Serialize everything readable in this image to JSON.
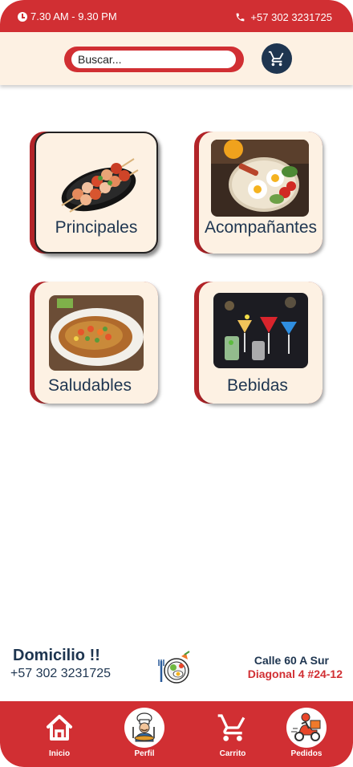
{
  "status_bar": {
    "hours": "7.30 AM - 9.30 PM",
    "phone": "+57 302 3231725",
    "clock_icon": "clock-icon",
    "phone_icon": "phone-icon"
  },
  "search": {
    "placeholder": "Buscar...",
    "value": ""
  },
  "categories": [
    {
      "label": "Principales",
      "image": "skewers-on-plate",
      "selected": true
    },
    {
      "label": "Acompañantes",
      "image": "breakfast-platter",
      "selected": false
    },
    {
      "label": "Saludables",
      "image": "fried-fish-salad",
      "selected": false
    },
    {
      "label": "Bebidas",
      "image": "cocktail-glasses",
      "selected": false
    }
  ],
  "delivery": {
    "title": "Domicilio !!",
    "phone": "+57 302 3231725",
    "address_line1": "Calle 60 A Sur",
    "address_line2": "Diagonal 4  #24-12",
    "icon": "food-plate-icon"
  },
  "bottom_nav": [
    {
      "label": "Inicio",
      "icon": "home-icon"
    },
    {
      "label": "Perfil",
      "icon": "chef-icon"
    },
    {
      "label": "Carrito",
      "icon": "cart-icon"
    },
    {
      "label": "Pedidos",
      "icon": "delivery-scooter-icon"
    }
  ],
  "colors": {
    "primary_red": "#d12f33",
    "navy": "#1e3550",
    "cream": "#fdf1e3"
  }
}
